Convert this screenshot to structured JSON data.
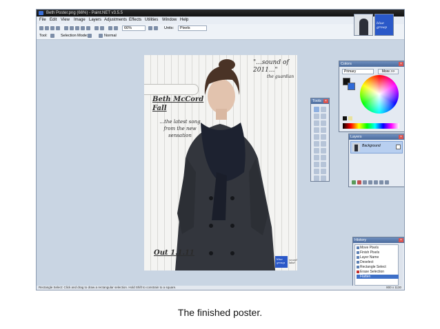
{
  "window": {
    "title": "Beth Poster.png (66%) - Paint.NET v3.5.5"
  },
  "menu": {
    "items": [
      "File",
      "Edit",
      "View",
      "Image",
      "Layers",
      "Adjustments",
      "Effects",
      "Utilities",
      "Window",
      "Help"
    ]
  },
  "toolbar": {
    "zoom": "66%",
    "units_label": "Units:",
    "units_value": "Pixels",
    "tool_label": "Tool:",
    "selection_mode_label": "Selection Mode:",
    "blend_mode": "Normal"
  },
  "thumbnail_badge": "blue group",
  "poster": {
    "quote": "\"...sound of 2011...\"",
    "quote_source": "the guardian",
    "artist": "Beth McCord",
    "song": "Fall",
    "tagline": "...the latest song from the new sensation",
    "date": "Out 1.1.11",
    "badge": "blue group",
    "badge_small": "record label"
  },
  "tools_panel": {
    "title": "Tools"
  },
  "colors_panel": {
    "title": "Colors",
    "primary": "Primary",
    "more_button": "More >>"
  },
  "layers_panel": {
    "title": "Layers",
    "layer_name": "Background"
  },
  "history_panel": {
    "title": "History",
    "items": [
      "Move Pixels",
      "Finish Pixels",
      "Layer Name",
      "Deselect",
      "Rectangle Select",
      "Erase Selection",
      "Flatten"
    ]
  },
  "status_bar": {
    "hint": "Rectangle Select: Click and drag to draw a rectangular selection. Hold Shift to constrain to a square.",
    "size": "800 x 1130"
  },
  "caption": "The finished poster.",
  "colors": {
    "workspace": "#c9d5e3",
    "panel_header": "#4a6a9c",
    "accent": "#2a58c8"
  }
}
